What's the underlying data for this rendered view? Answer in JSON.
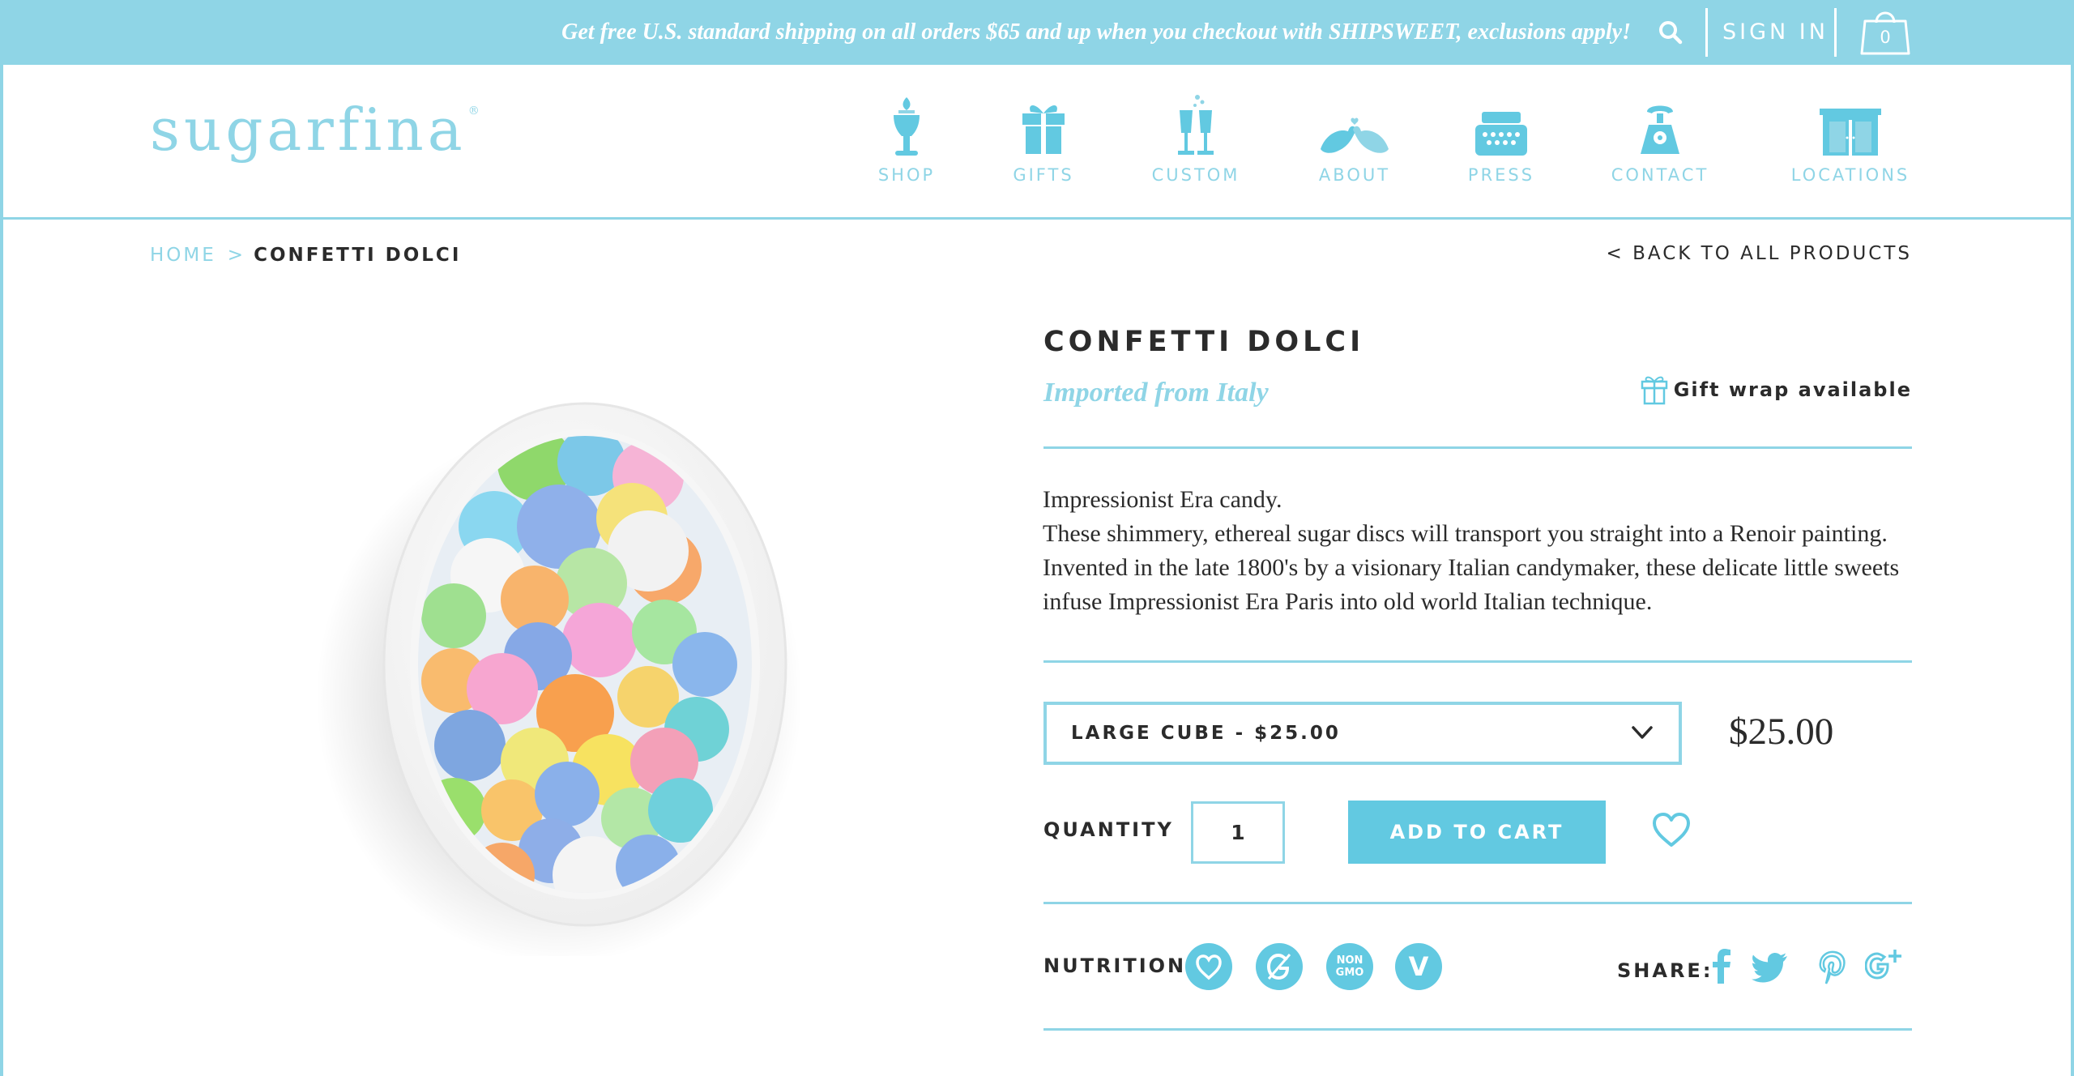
{
  "topbar": {
    "promo": "Get free U.S. standard shipping on all orders $65 and up when you checkout with SHIPSWEET, exclusions apply!",
    "signin": "SIGN IN",
    "cart_count": "0"
  },
  "brand": {
    "name": "sugarfina",
    "mark": "®"
  },
  "nav": [
    {
      "label": "SHOP",
      "icon": "candy-jar-icon"
    },
    {
      "label": "GIFTS",
      "icon": "gift-box-icon"
    },
    {
      "label": "CUSTOM",
      "icon": "champagne-glasses-icon"
    },
    {
      "label": "ABOUT",
      "icon": "love-birds-icon"
    },
    {
      "label": "PRESS",
      "icon": "typewriter-icon"
    },
    {
      "label": "CONTACT",
      "icon": "telephone-icon"
    },
    {
      "label": "LOCATIONS",
      "icon": "storefront-icon"
    }
  ],
  "breadcrumb": {
    "home": "HOME",
    "separator": ">",
    "current": "CONFETTI DOLCI"
  },
  "back_link": "< BACK TO ALL PRODUCTS",
  "product": {
    "title": "CONFETTI DOLCI",
    "subtitle": "Imported from Italy",
    "gift_wrap": "Gift wrap available",
    "description": [
      "Impressionist Era candy.",
      "These shimmery, ethereal sugar discs will transport you straight into a Renoir painting. Invented in the late 1800's by a visionary Italian candymaker, these delicate little sweets infuse Impressionist Era Paris into old world Italian technique."
    ],
    "size_option": "LARGE CUBE - $25.00",
    "price": "$25.00",
    "quantity_label": "QUANTITY",
    "quantity": "1",
    "add_to_cart": "ADD TO CART",
    "nutrition_label": "NUTRITION:",
    "nutrition_badges": [
      {
        "name": "heart-healthy",
        "icon": "heart-badge-icon"
      },
      {
        "name": "gluten-free",
        "icon": "gluten-free-badge-icon"
      },
      {
        "name": "non-gmo",
        "icon": "non-gmo-badge-icon",
        "text_top": "NON",
        "text_bottom": "GMO"
      },
      {
        "name": "vegan",
        "icon": "vegan-badge-icon",
        "text": "V"
      }
    ],
    "share_label": "SHARE:",
    "share": [
      "facebook-icon",
      "twitter-icon",
      "pinterest-icon",
      "google-plus-icon"
    ]
  },
  "colors": {
    "accent": "#8fd5e6",
    "button": "#62c9e1",
    "text": "#2b2b2b"
  }
}
